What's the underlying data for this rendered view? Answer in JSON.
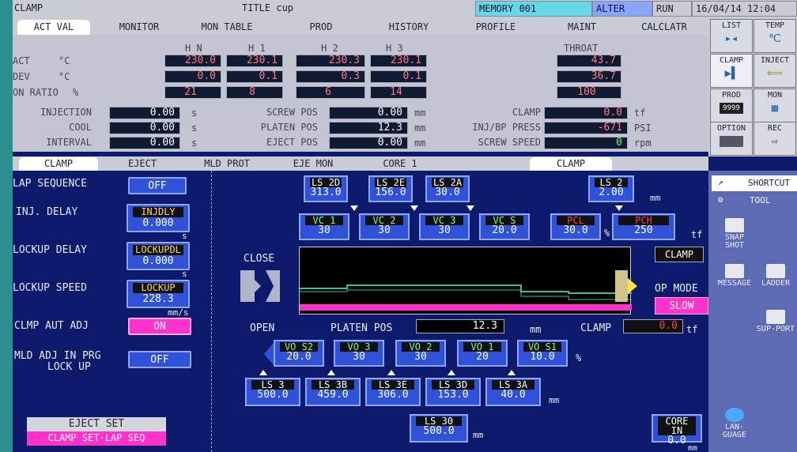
{
  "topbar": {
    "app": "CLAMP",
    "title": "TITLE  cup",
    "memory": "MEMORY 001",
    "alter": "ALTER",
    "run": "RUN",
    "datetime": "16/04/14 12:04"
  },
  "tabs": [
    "ACT VAL",
    "MONITOR",
    "MON TABLE",
    "PROD",
    "HISTORY",
    "PROFILE",
    "MAINT",
    "CALCLATR"
  ],
  "upper": {
    "cols": [
      "H N",
      "H 1",
      "H 2",
      "H 3"
    ],
    "throat": "THROAT",
    "rows": [
      {
        "label": "ACT",
        "unit": "°C",
        "vals": [
          "230.0",
          "230.1",
          "230.3",
          "230.1"
        ],
        "throat": "43.7"
      },
      {
        "label": "DEV",
        "unit": "°C",
        "vals": [
          "0.0",
          "0.1",
          "0.3",
          "0.1"
        ],
        "throat": "36.7"
      },
      {
        "label": "ON RATIO",
        "unit": "%",
        "vals": [
          "21",
          "8",
          "6",
          "14"
        ],
        "throat": "100"
      }
    ],
    "left": [
      {
        "label": "INJECTION",
        "val": "0.00",
        "unit": "s"
      },
      {
        "label": "COOL",
        "val": "0.00",
        "unit": "s"
      },
      {
        "label": "INTERVAL",
        "val": "0.00",
        "unit": "s"
      }
    ],
    "mid": [
      {
        "label": "SCREW POS",
        "val": "0.00",
        "unit": "mm"
      },
      {
        "label": "PLATEN POS",
        "val": "12.3",
        "unit": "mm"
      },
      {
        "label": "EJECT POS",
        "val": "0.00",
        "unit": "mm"
      }
    ],
    "right": [
      {
        "label": "CLAMP",
        "val": "0.0",
        "unit": "tf"
      },
      {
        "label": "INJ/BP PRESS",
        "val": "-671",
        "unit": "PSI"
      },
      {
        "label": "SCREW SPEED",
        "val": "0",
        "unit": "rpm"
      }
    ]
  },
  "rightpanel": [
    {
      "label": "LIST",
      "icon": "list-icon"
    },
    {
      "label": "TEMP",
      "icon": "temp-icon",
      "glyph": "℃"
    },
    {
      "label": "CLAMP",
      "icon": "clamp-icon"
    },
    {
      "label": "INJECT",
      "icon": "inject-icon"
    },
    {
      "label": "PROD",
      "icon": "prod-icon",
      "glyph": "9999"
    },
    {
      "label": "MON",
      "icon": "mon-icon"
    },
    {
      "label": "OPTION",
      "icon": "option-icon"
    },
    {
      "label": "REC",
      "icon": "rec-icon"
    }
  ],
  "tabs2": [
    "CLAMP",
    "EJECT",
    "MLD PROT",
    "EJE MON",
    "CORE 1",
    "CLAMP"
  ],
  "left": {
    "lap_sequence": {
      "label": "LAP SEQUENCE",
      "value": "OFF"
    },
    "inj_delay": {
      "label": "INJ. DELAY",
      "name": "INJDLY",
      "value": "0.000",
      "unit": "s"
    },
    "lockup_delay": {
      "label": "LOCKUP DELAY",
      "name": "LOCKUPDL",
      "value": "0.000",
      "unit": "s"
    },
    "lockup_speed": {
      "label": "LOCKUP SPEED",
      "name": "LOCKUP",
      "value": "228.3",
      "unit": "mm/s"
    },
    "clmp_aut_adj": {
      "label": "CLMP AUT ADJ",
      "value": "ON"
    },
    "mld_adj": {
      "label1": "MLD ADJ IN PRG",
      "label2": "LOCK UP",
      "value": "OFF"
    },
    "eject_set": "EJECT SET",
    "clamp_set": "CLAMP SET·LAP SEQ"
  },
  "center": {
    "ls_top": [
      {
        "name": "LS 2D",
        "val": "313.0"
      },
      {
        "name": "LS 2E",
        "val": "156.0"
      },
      {
        "name": "LS 2A",
        "val": "30.0"
      }
    ],
    "ls2": {
      "name": "LS 2",
      "val": "2.00",
      "unit": "mm"
    },
    "vc": [
      {
        "name": "VC 1",
        "val": "30"
      },
      {
        "name": "VC 2",
        "val": "30"
      },
      {
        "name": "VC 3",
        "val": "30"
      },
      {
        "name": "VC S",
        "val": "20.0"
      }
    ],
    "pcl": {
      "name": "PCL",
      "val": "30.0",
      "unit": "%"
    },
    "pch": {
      "name": "PCH",
      "val": "250",
      "unit": "tf"
    },
    "close": "CLOSE",
    "open": "OPEN",
    "clamp_label": "CLAMP",
    "op_mode": "OP MODE",
    "slow": "SLOW",
    "platen_pos": {
      "label": "PLATEN POS",
      "val": "12.3",
      "unit": "mm"
    },
    "clamp_force": {
      "label": "CLAMP",
      "val": "0.0",
      "unit": "tf"
    },
    "vo": [
      {
        "name": "VO S2",
        "val": "20.0"
      },
      {
        "name": "VO 3",
        "val": "30"
      },
      {
        "name": "VO 2",
        "val": "30"
      },
      {
        "name": "VO 1",
        "val": "20"
      },
      {
        "name": "VO S1",
        "val": "10.0"
      }
    ],
    "vo_unit": "%",
    "ls_bottom": [
      {
        "name": "LS 3",
        "val": "500.0"
      },
      {
        "name": "LS 3B",
        "val": "459.0"
      },
      {
        "name": "LS 3E",
        "val": "306.0"
      },
      {
        "name": "LS 3D",
        "val": "153.0"
      },
      {
        "name": "LS 3A",
        "val": "40.0"
      }
    ],
    "ls_unit": "mm",
    "ls30": {
      "name": "LS 30",
      "val": "500.0",
      "unit": "mm"
    },
    "corein": {
      "name": "CORE IN",
      "val": "0.0",
      "unit": "mm"
    }
  },
  "tools": {
    "shortcut": "SHORTCUT",
    "tool": "TOOL",
    "snap": "SNAP SHOT",
    "message": "MESSAGE",
    "ladder": "LADDER",
    "support": "SUP-PORT",
    "language": "LAN-GUAGE"
  }
}
